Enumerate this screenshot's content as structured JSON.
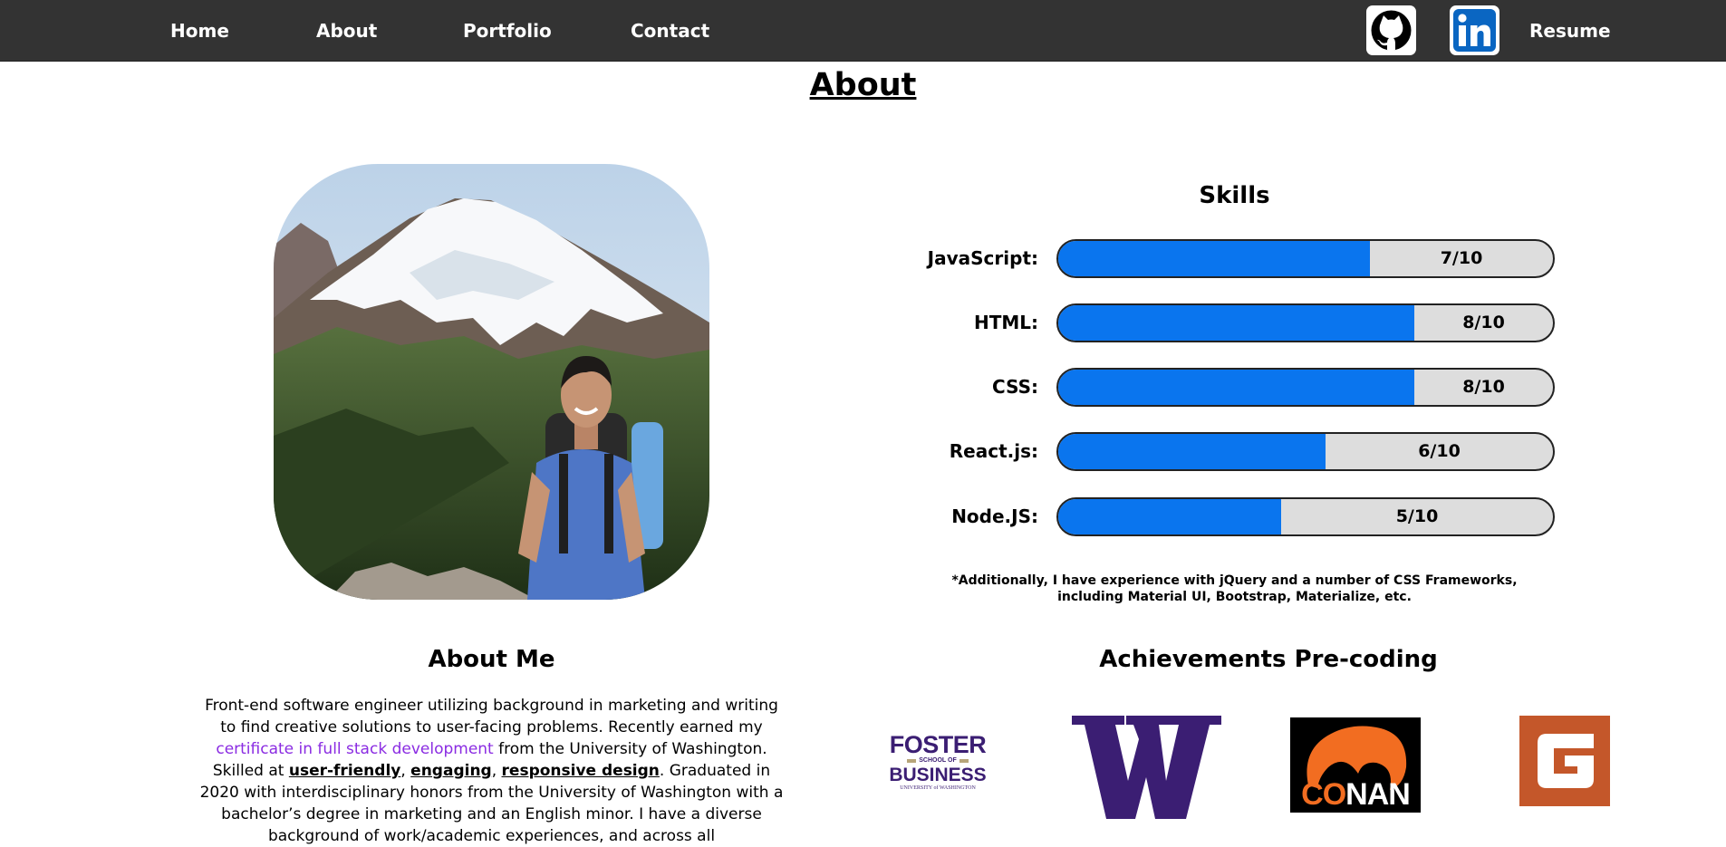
{
  "nav": {
    "home": "Home",
    "about": "About",
    "portfolio": "Portfolio",
    "contact": "Contact",
    "resume": "Resume",
    "github_icon": "github-icon",
    "linkedin_icon": "linkedin-icon"
  },
  "page_title": "About",
  "skills": {
    "title": "Skills",
    "items": [
      {
        "label": "JavaScript:",
        "score": "7/10",
        "value": 7
      },
      {
        "label": "HTML:",
        "score": "8/10",
        "value": 8
      },
      {
        "label": "CSS:",
        "score": "8/10",
        "value": 8
      },
      {
        "label": "React.js:",
        "score": "6/10",
        "value": 6
      },
      {
        "label": "Node.JS:",
        "score": "5/10",
        "value": 5
      }
    ],
    "footnote": "*Additionally, I have experience with jQuery and a number of CSS Frameworks, including Material UI, Bootstrap, Materialize, etc."
  },
  "about_me": {
    "title": "About Me",
    "text_1": "Front-end software engineer utilizing background in marketing and writing to find creative solutions to user-facing problems. Recently earned my ",
    "link": "certificate in full stack development",
    "text_2": " from the University of Washington. Skilled at ",
    "kw_1": "user-friendly",
    "sep_1": ", ",
    "kw_2": "engaging",
    "sep_2": ", ",
    "kw_3": "responsive design",
    "text_3": ". Graduated in 2020 with interdisciplinary honors from the University of Washington with a bachelor’s degree in marketing and an English minor. I have a diverse background of work/academic experiences, and across all"
  },
  "achievements": {
    "title": "Achievements Pre-coding",
    "logos": {
      "foster_1": "FOSTER",
      "foster_2": "SCHOOL OF",
      "foster_3": "BUSINESS",
      "foster_4": "UNIVERSITY of WASHINGTON",
      "uw": "W",
      "conan_1": "CO",
      "conan_2": "NAN"
    }
  },
  "colors": {
    "navbar": "#333333",
    "skill_fill": "#0a75ee",
    "skill_track": "#dddddd",
    "link": "#8a2be2",
    "uw_purple": "#3b1e73",
    "conan_orange": "#f26d21",
    "g_orange": "#c4572a"
  }
}
